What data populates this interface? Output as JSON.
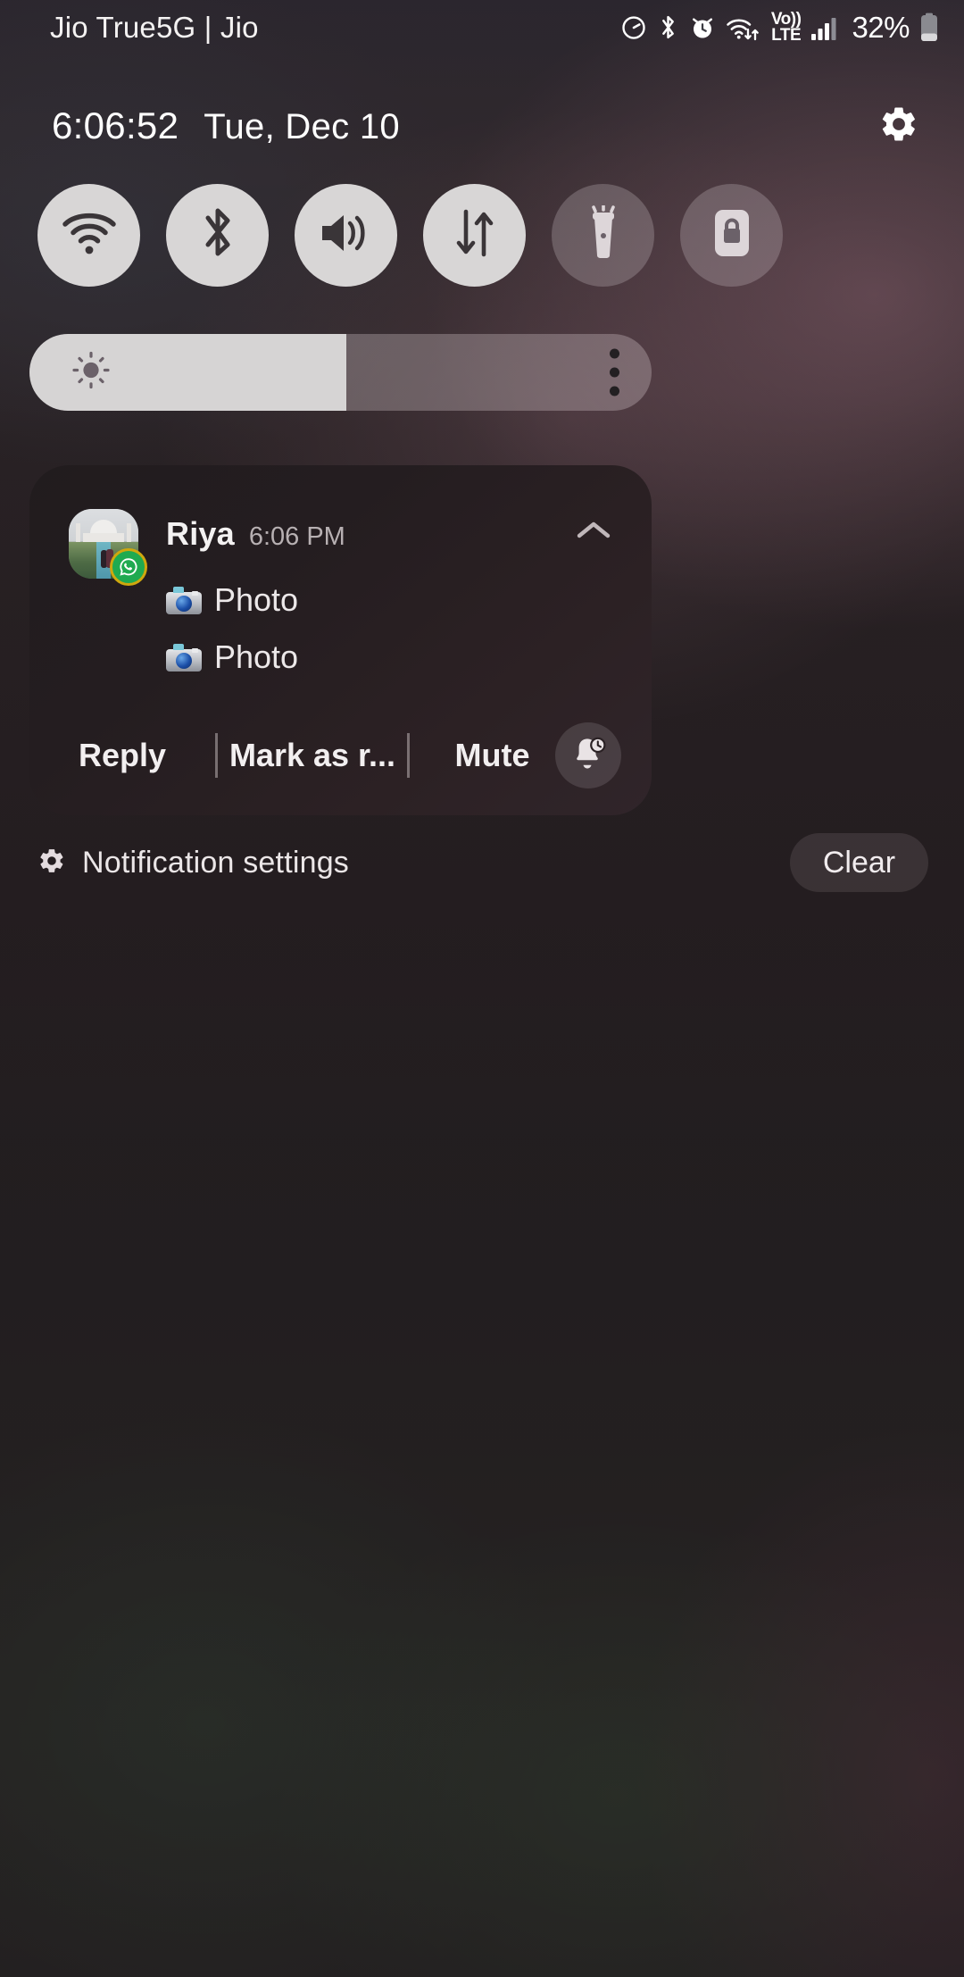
{
  "statusbar": {
    "carrier": "Jio True5G | Jio",
    "battery_percent": "32%",
    "icons": [
      "data-saver-icon",
      "bluetooth-icon",
      "alarm-icon",
      "wifi-transfer-icon",
      "volte-icon",
      "cellular-signal-icon",
      "battery-icon"
    ],
    "volte_top": "Vo))",
    "volte_bottom": "LTE"
  },
  "header": {
    "time": "6:06:52",
    "date": "Tue, Dec 10",
    "settings_icon": "gear-icon"
  },
  "quick_settings": {
    "tiles": [
      {
        "name": "wifi",
        "icon": "wifi-icon",
        "state": "on"
      },
      {
        "name": "bluetooth",
        "icon": "bluetooth-icon",
        "state": "on"
      },
      {
        "name": "sound",
        "icon": "volume-icon",
        "state": "on"
      },
      {
        "name": "mobile-data",
        "icon": "data-arrows-icon",
        "state": "on"
      },
      {
        "name": "flashlight",
        "icon": "flashlight-icon",
        "state": "off"
      },
      {
        "name": "auto-rotate",
        "icon": "rotation-lock-icon",
        "state": "off"
      }
    ]
  },
  "brightness": {
    "icon": "brightness-sun-icon",
    "level_percent": 51,
    "overflow_icon": "more-vertical-icon"
  },
  "notification": {
    "app": "whatsapp",
    "sender": "Riya",
    "time": "6:06 PM",
    "avatar_badge_icon": "whatsapp-icon",
    "collapse_icon": "chevron-up-icon",
    "lines": [
      {
        "icon": "camera-emoji",
        "text": "Photo"
      },
      {
        "icon": "camera-emoji",
        "text": "Photo"
      }
    ],
    "actions": [
      {
        "name": "reply",
        "label": "Reply"
      },
      {
        "name": "mark-as-read",
        "label": "Mark as r..."
      },
      {
        "name": "mute",
        "label": "Mute"
      }
    ],
    "snooze_icon": "bell-clock-icon"
  },
  "footer": {
    "settings_icon": "gear-icon",
    "settings_label": "Notification settings",
    "clear_label": "Clear"
  },
  "colors": {
    "accent_light": "#d8d6d6",
    "card_bg": "#241d20",
    "whatsapp_green": "#1faa50",
    "badge_ring": "#cfa80e",
    "text_primary": "#f3f1f1",
    "text_secondary": "#b7b0b2"
  }
}
